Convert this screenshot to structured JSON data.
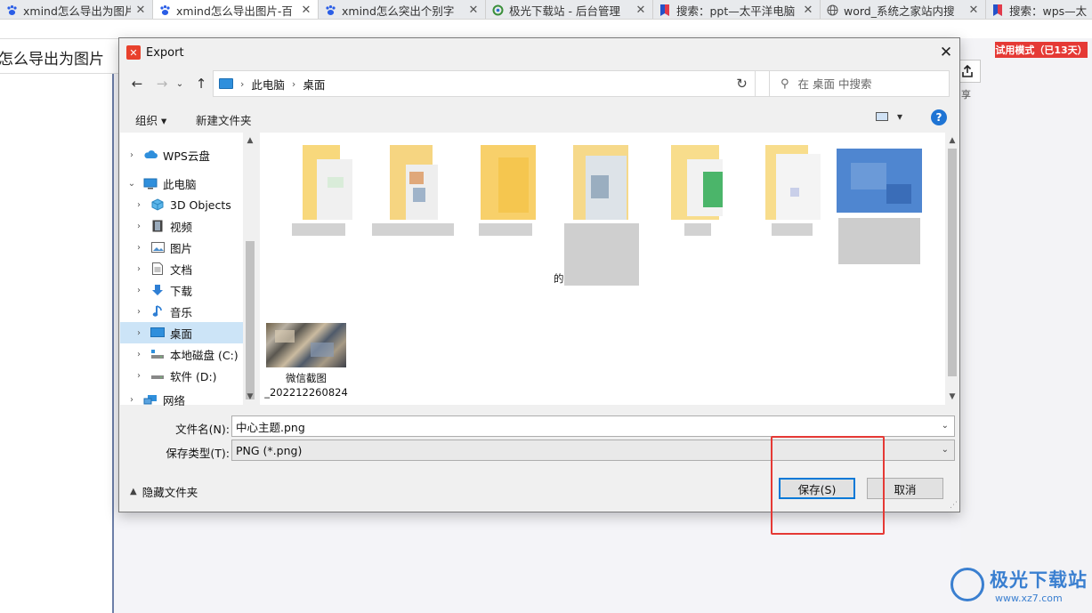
{
  "browser": {
    "tabs": [
      {
        "icon": "baidu-paw-icon",
        "label": "xmind怎么导出为图片_"
      },
      {
        "icon": "baidu-paw-icon",
        "label": "xmind怎么导出图片-百"
      },
      {
        "icon": "baidu-paw-icon",
        "label": "xmind怎么突出个别字"
      },
      {
        "icon": "jiguang-logo-icon",
        "label": "极光下载站 - 后台管理"
      },
      {
        "icon": "bookmark-icon",
        "label": "搜索：ppt—太平洋电脑"
      },
      {
        "icon": "globe-icon",
        "label": "word_系统之家站内搜"
      },
      {
        "icon": "bookmark-icon",
        "label": "搜索：wps—太"
      }
    ],
    "close_glyph": "✕"
  },
  "background": {
    "page_title": "怎么导出为图片",
    "trial_badge": "试用模式（已13天）",
    "share_label": "享"
  },
  "dialog": {
    "title": "Export",
    "address": {
      "crumbs": [
        "此电脑",
        "桌面"
      ]
    },
    "search": {
      "placeholder": "在 桌面 中搜索"
    },
    "toolbar": {
      "organize": "组织 ▾",
      "new_folder": "新建文件夹",
      "help": "?"
    },
    "nav": {
      "items": [
        {
          "label": "WPS云盘",
          "icon": "cloud-icon",
          "chev": "›",
          "indent": 0
        },
        {
          "label": "此电脑",
          "icon": "computer-icon",
          "chev": "⌄",
          "indent": 0
        },
        {
          "label": "3D Objects",
          "icon": "cube-icon",
          "chev": "›",
          "indent": 1
        },
        {
          "label": "视频",
          "icon": "video-icon",
          "chev": "›",
          "indent": 1
        },
        {
          "label": "图片",
          "icon": "picture-icon",
          "chev": "›",
          "indent": 1
        },
        {
          "label": "文档",
          "icon": "document-icon",
          "chev": "›",
          "indent": 1
        },
        {
          "label": "下载",
          "icon": "download-icon",
          "chev": "›",
          "indent": 1
        },
        {
          "label": "音乐",
          "icon": "music-icon",
          "chev": "›",
          "indent": 1
        },
        {
          "label": "桌面",
          "icon": "desktop-icon",
          "chev": "›",
          "indent": 1,
          "selected": true
        },
        {
          "label": "本地磁盘 (C:)",
          "icon": "drive-c-icon",
          "chev": "›",
          "indent": 1
        },
        {
          "label": "软件 (D:)",
          "icon": "drive-d-icon",
          "chev": "›",
          "indent": 1
        },
        {
          "label": "网络",
          "icon": "network-icon",
          "chev": "›",
          "indent": 0
        }
      ]
    },
    "files": {
      "partial_char": "的",
      "screenshot_file": {
        "label_line1": "微信截图",
        "label_line2": "_202212260824"
      }
    },
    "filename": {
      "label": "文件名(N):",
      "value": "中心主题.png"
    },
    "filetype": {
      "label": "保存类型(T):",
      "value": "PNG (*.png)"
    },
    "hide_folders": "隐藏文件夹",
    "save_button": "保存(S)",
    "cancel_button": "取消"
  },
  "watermark": {
    "line1": "极光下载站",
    "line2": "www.xz7.com"
  },
  "colors": {
    "accent": "#0078d7",
    "annotation": "#e53935",
    "selection": "#cce4f7"
  }
}
